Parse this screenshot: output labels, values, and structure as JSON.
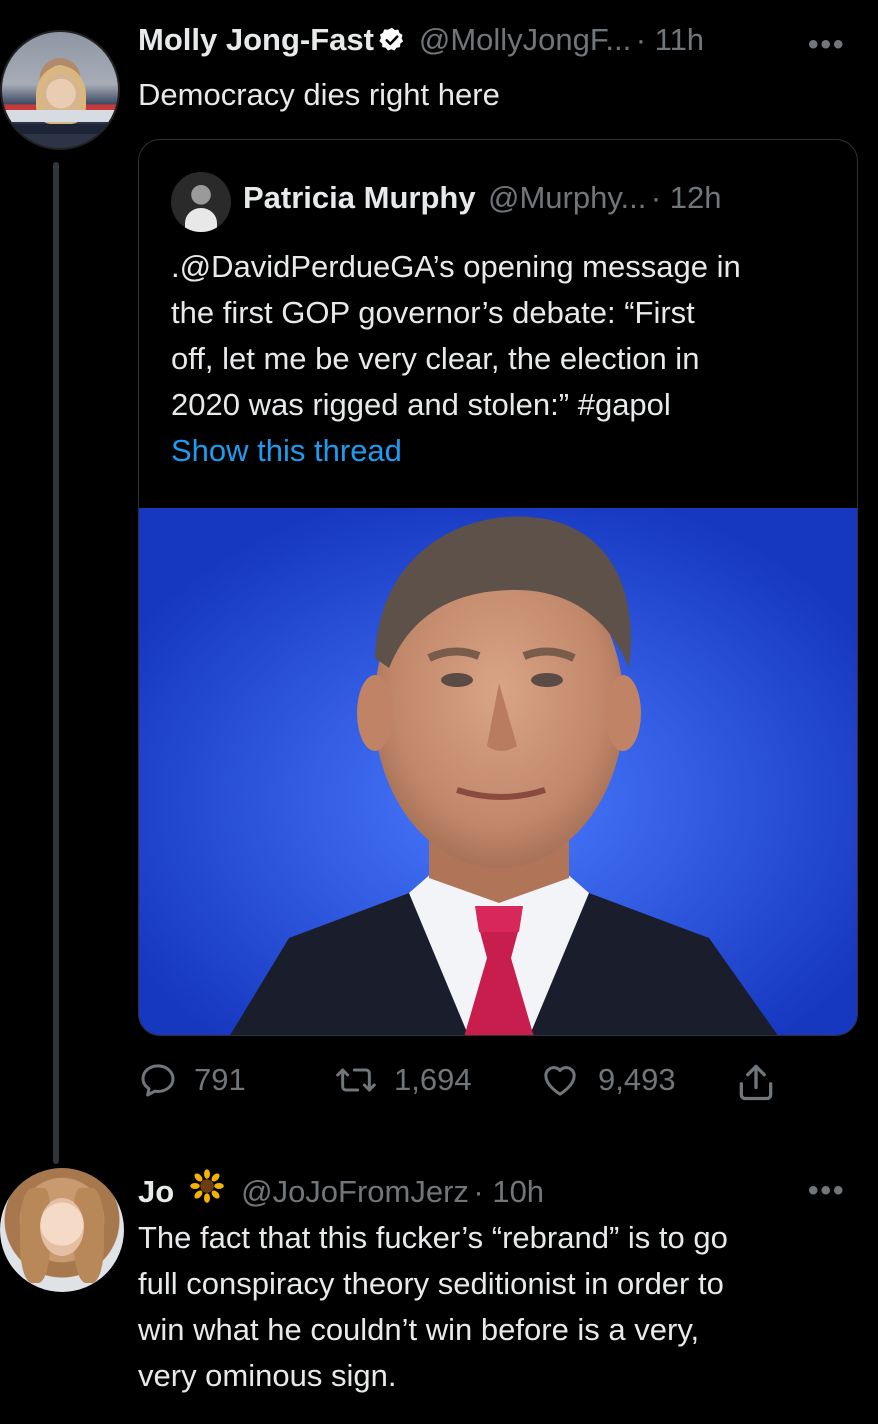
{
  "tweet": {
    "author": {
      "name": "Molly Jong-Fast",
      "handle": "@MollyJongF...",
      "time": "· 11h",
      "avatar_icon": "profile-photo"
    },
    "text": "Democracy dies right here",
    "more_label": "•••",
    "quoted": {
      "author": {
        "name": "Patricia Murphy",
        "handle": "@Murphy...",
        "time": "· 12h"
      },
      "text_lines": [
        ".@DavidPerdueGA’s opening message in",
        "the first GOP governor’s debate: “First",
        "off, let me be very clear, the election in",
        "2020 was rigged and stolen:” #gapol"
      ],
      "show_thread_label": "Show this thread",
      "media_icon": "photo-man-in-suit-blue-background"
    },
    "stats": {
      "replies": "791",
      "retweets": "1,694",
      "likes": "9,493"
    }
  },
  "reply": {
    "author": {
      "name": "Jo",
      "emoji": "🌻",
      "handle": "@JoJoFromJerz",
      "time": "· 10h"
    },
    "more_label": "•••",
    "text_lines": [
      "The fact that this fucker’s “rebrand” is to go",
      "full conspiracy theory seditionist in order to",
      "win what he couldn’t win before is a very,",
      "very ominous sign."
    ]
  },
  "colors": {
    "background": "#000000",
    "text": "#e7e9ea",
    "secondary": "#71767b",
    "link": "#1d9bf0",
    "verified_badge": "#ffffff"
  }
}
